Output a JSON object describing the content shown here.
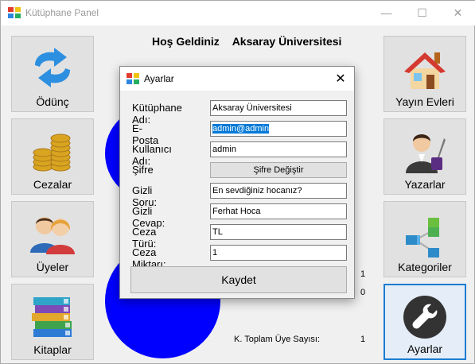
{
  "window": {
    "title": "Kütüphane Panel",
    "minimize": "—",
    "maximize": "☐",
    "close": "✕"
  },
  "welcome": {
    "greeting": "Hoş Geldiniz",
    "institution": "Aksaray Üniversitesi"
  },
  "tiles": {
    "odunc": "Ödünç",
    "cezalar": "Cezalar",
    "uyeler": "Üyeler",
    "kitaplar": "Kitaplar",
    "yayin_evleri": "Yayın Evleri",
    "yazarlar": "Yazarlar",
    "kategoriler": "Kategoriler",
    "ayarlar": "Ayarlar"
  },
  "stats": {
    "value1": "1",
    "value2": "0",
    "toplam_uye_label": "K. Toplam Üye Sayısı:",
    "toplam_uye_value": "1"
  },
  "dialog": {
    "title": "Ayarlar",
    "close": "✕",
    "fields": {
      "kutuphane_adi": {
        "label": "Kütüphane Adı:",
        "value": "Aksaray Üniversitesi"
      },
      "eposta": {
        "label": "E-Posta",
        "value": "admin@admin"
      },
      "kullanici_adi": {
        "label": "Kullanıcı Adı:",
        "value": "admin"
      },
      "sifre": {
        "label": "Şifre",
        "button": "Şifre Değiştir"
      },
      "gizli_soru": {
        "label": "Gizli Soru:",
        "value": "En sevdiğiniz hocanız?"
      },
      "gizli_cevap": {
        "label": "Gizli Cevap:",
        "value": "Ferhat Hoca"
      },
      "ceza_turu": {
        "label": "Ceza Türü:",
        "value": "TL"
      },
      "ceza_miktari": {
        "label": "Ceza Miktarı:",
        "value": "1"
      }
    },
    "save_label": "Kaydet"
  },
  "colors": {
    "accent": "#0078d7",
    "circle": "#0000ff",
    "selected_border": "#1b7cd1"
  },
  "icons": [
    "app-icon",
    "swap-arrows-icon",
    "coins-icon",
    "users-icon",
    "books-icon",
    "house-icon",
    "writer-icon",
    "category-blocks-icon",
    "wrench-icon",
    "close-icon"
  ]
}
